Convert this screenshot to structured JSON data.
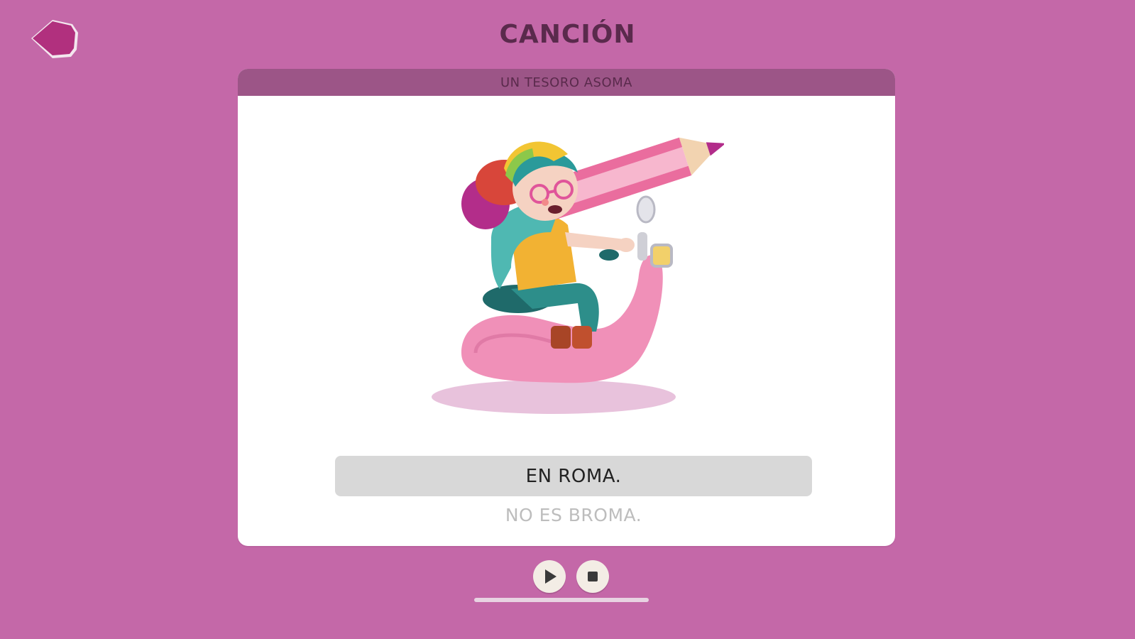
{
  "header": {
    "title": "CANCIÓN",
    "back_icon": "back-arrow-icon"
  },
  "card": {
    "song_title": "UN TESORO ASOMA",
    "illustration": "girl-riding-snail-scooter-with-pencil",
    "current_line": "EN ROMA.",
    "next_line": "NO ES BROMA."
  },
  "player": {
    "play_icon": "play-icon",
    "stop_icon": "stop-icon",
    "progress": 0.0
  },
  "colors": {
    "background": "#c468a8",
    "header_bar": "#9c5587",
    "title_text": "#5a2a4c",
    "highlight": "#d8d8d8"
  }
}
